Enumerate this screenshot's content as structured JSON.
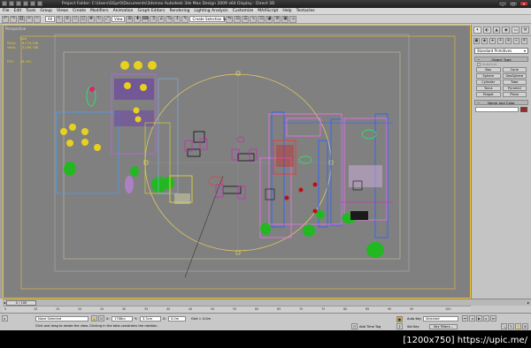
{
  "title_bar": {
    "title": "Project Folder: C:\\Users\\SGpr0\\Documents\\3dsmax     Autodesk 3ds Max Design 2009 x64          Display : Direct 3D"
  },
  "menu": [
    "File",
    "Edit",
    "Tools",
    "Group",
    "Views",
    "Create",
    "Modifiers",
    "Animation",
    "Graph Editors",
    "Rendering",
    "Lighting Analysis",
    "Customize",
    "MAXScript",
    "Help",
    "Tentacles"
  ],
  "toolbar": {
    "filter_value": "All",
    "coord_value": "View",
    "selection_set_placeholder": "Create Selection Set"
  },
  "viewport": {
    "label": "Perspective",
    "stats": {
      "header": "Total",
      "polys_label": "Polys:",
      "polys_value": "6,074,308",
      "verts_label": "Verts:",
      "verts_value": "3,098,788"
    },
    "fps_label": "FPS:",
    "fps_value": "28.791"
  },
  "command_panel": {
    "tabs": [
      "✦",
      "◐",
      "▲",
      "◉",
      "▭",
      "⚒"
    ],
    "create_icons": [
      "●",
      "◆",
      "★",
      "☀",
      "⊕",
      "≈",
      "✲"
    ],
    "primitive_type": "Standard Primitives",
    "object_type_header": "Object Type",
    "autogrid_label": "AutoGrid",
    "objects": [
      "Box",
      "Cone",
      "Sphere",
      "GeoSphere",
      "Cylinder",
      "Tube",
      "Torus",
      "Pyramid",
      "Teapot",
      "Plane"
    ],
    "name_color_header": "Name and Color",
    "swatch_color": "#9a2828"
  },
  "time": {
    "slider_label": "0 / 100",
    "ticks": [
      "0",
      "10",
      "15",
      "20",
      "25",
      "30",
      "35",
      "40",
      "45",
      "50",
      "55",
      "60",
      "65",
      "70",
      "75",
      "80",
      "85",
      "90",
      "95",
      "100"
    ]
  },
  "status": {
    "selection_text": "None Selected",
    "prompt_text": "Click and drag to rotate the view.  Clicking in the tabs constrains the rotation.",
    "x_label": "X:",
    "x_value": "1768cc",
    "y_label": "Y:",
    "y_value": "3.3cm",
    "z_label": "Z:",
    "z_value": "0.0m",
    "grid_text": "Grid = 0.0m",
    "add_time_tag": "Add Time Tag",
    "auto_key": "Auto Key",
    "set_key": "Set Key",
    "selected_dd": "Selected",
    "key_filters": "Key Filters..."
  },
  "watermark": "[1200x750] https://upic.me/"
}
